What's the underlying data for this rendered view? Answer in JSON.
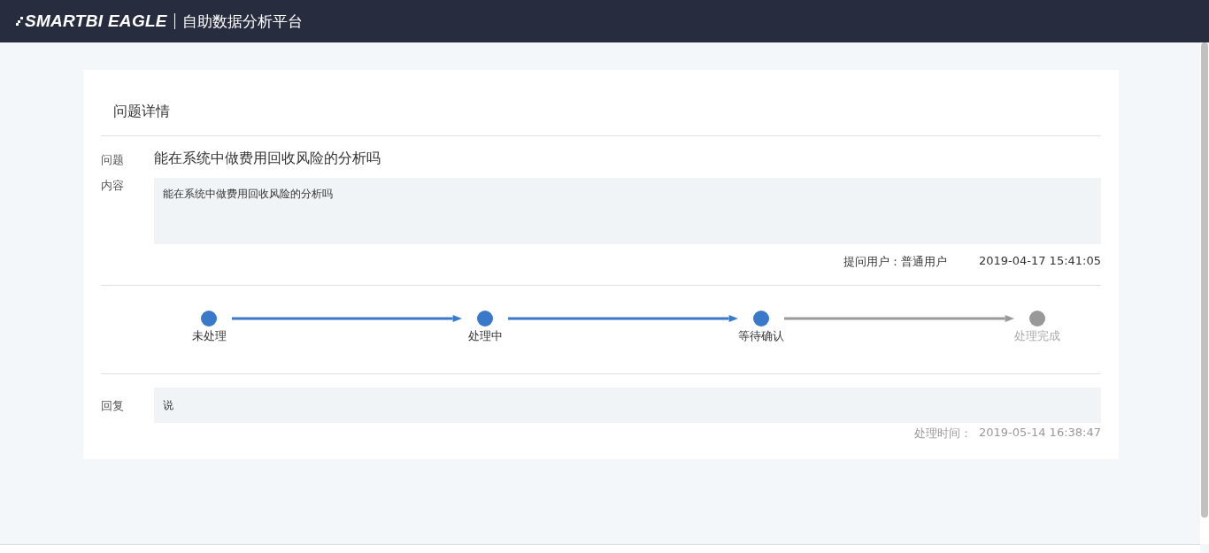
{
  "header": {
    "logo": "SMARTBI EAGLE",
    "title": "自助数据分析平台"
  },
  "detail": {
    "heading": "问题详情",
    "question_label": "问题",
    "question": "能在系统中做费用回收风险的分析吗",
    "content_label": "内容",
    "content": "能在系统中做费用回收风险的分析吗",
    "asker": "提问用户：普通用户",
    "asked_at": "2019-04-17 15:41:05",
    "steps": [
      {
        "label": "未处理",
        "done": true
      },
      {
        "label": "处理中",
        "done": true
      },
      {
        "label": "等待确认",
        "done": true
      },
      {
        "label": "处理完成",
        "done": false
      }
    ],
    "reply_label": "回复",
    "reply": "说",
    "handled_label": "处理时间：",
    "handled_at": "2019-05-14 16:38:47"
  }
}
